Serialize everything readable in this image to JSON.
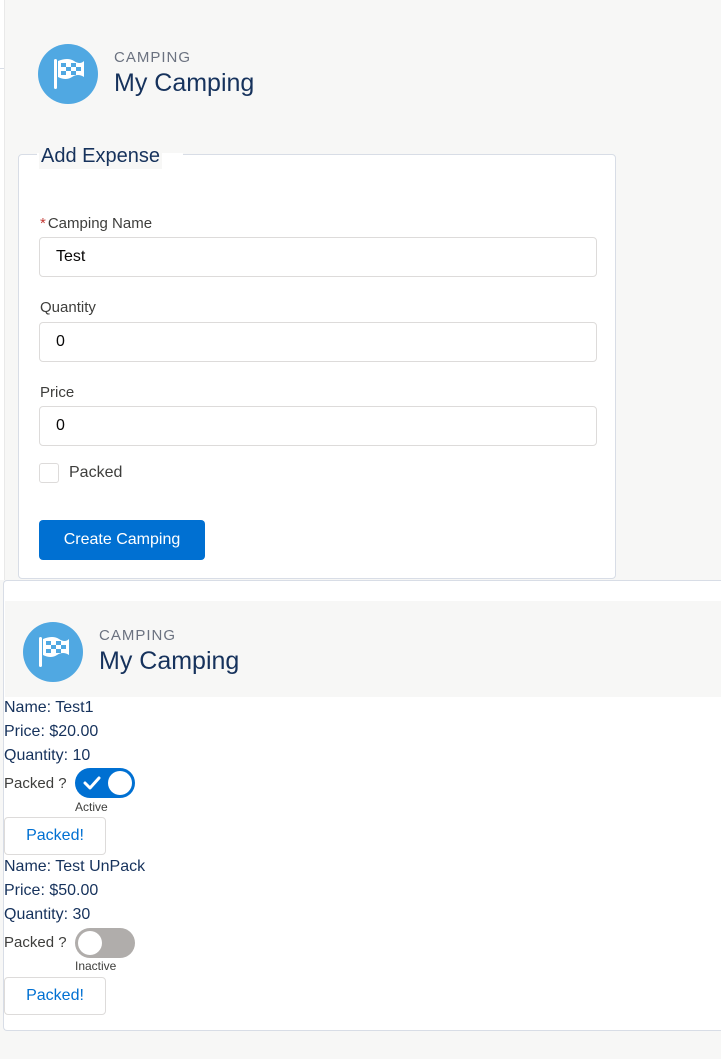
{
  "header": {
    "eyebrow": "CAMPING",
    "title": "My Camping",
    "icon": "checkered-flag-icon"
  },
  "form": {
    "title": "Add Expense",
    "required_marker": "*",
    "camping_name": {
      "label": "Camping Name",
      "value": "Test"
    },
    "quantity": {
      "label": "Quantity",
      "value": "0"
    },
    "price": {
      "label": "Price",
      "value": "0"
    },
    "packed": {
      "label": "Packed",
      "checked": false
    },
    "submit_label": "Create Camping"
  },
  "list": {
    "header": {
      "eyebrow": "CAMPING",
      "title": "My Camping"
    },
    "items": [
      {
        "name": "Name: Test1",
        "price": "Price: $20.00",
        "quantity": "Quantity: 10",
        "packed_label": "Packed ?",
        "toggle_state": "Active",
        "toggle_on": true,
        "button_label": "Packed!"
      },
      {
        "name": "Name: Test UnPack",
        "price": "Price: $50.00",
        "quantity": "Quantity: 30",
        "packed_label": "Packed ?",
        "toggle_state": "Inactive",
        "toggle_on": false,
        "button_label": "Packed!"
      }
    ]
  },
  "colors": {
    "brand": "#0070d2",
    "icon_bg": "#50a8e2",
    "toggle_off": "#b0adab"
  }
}
